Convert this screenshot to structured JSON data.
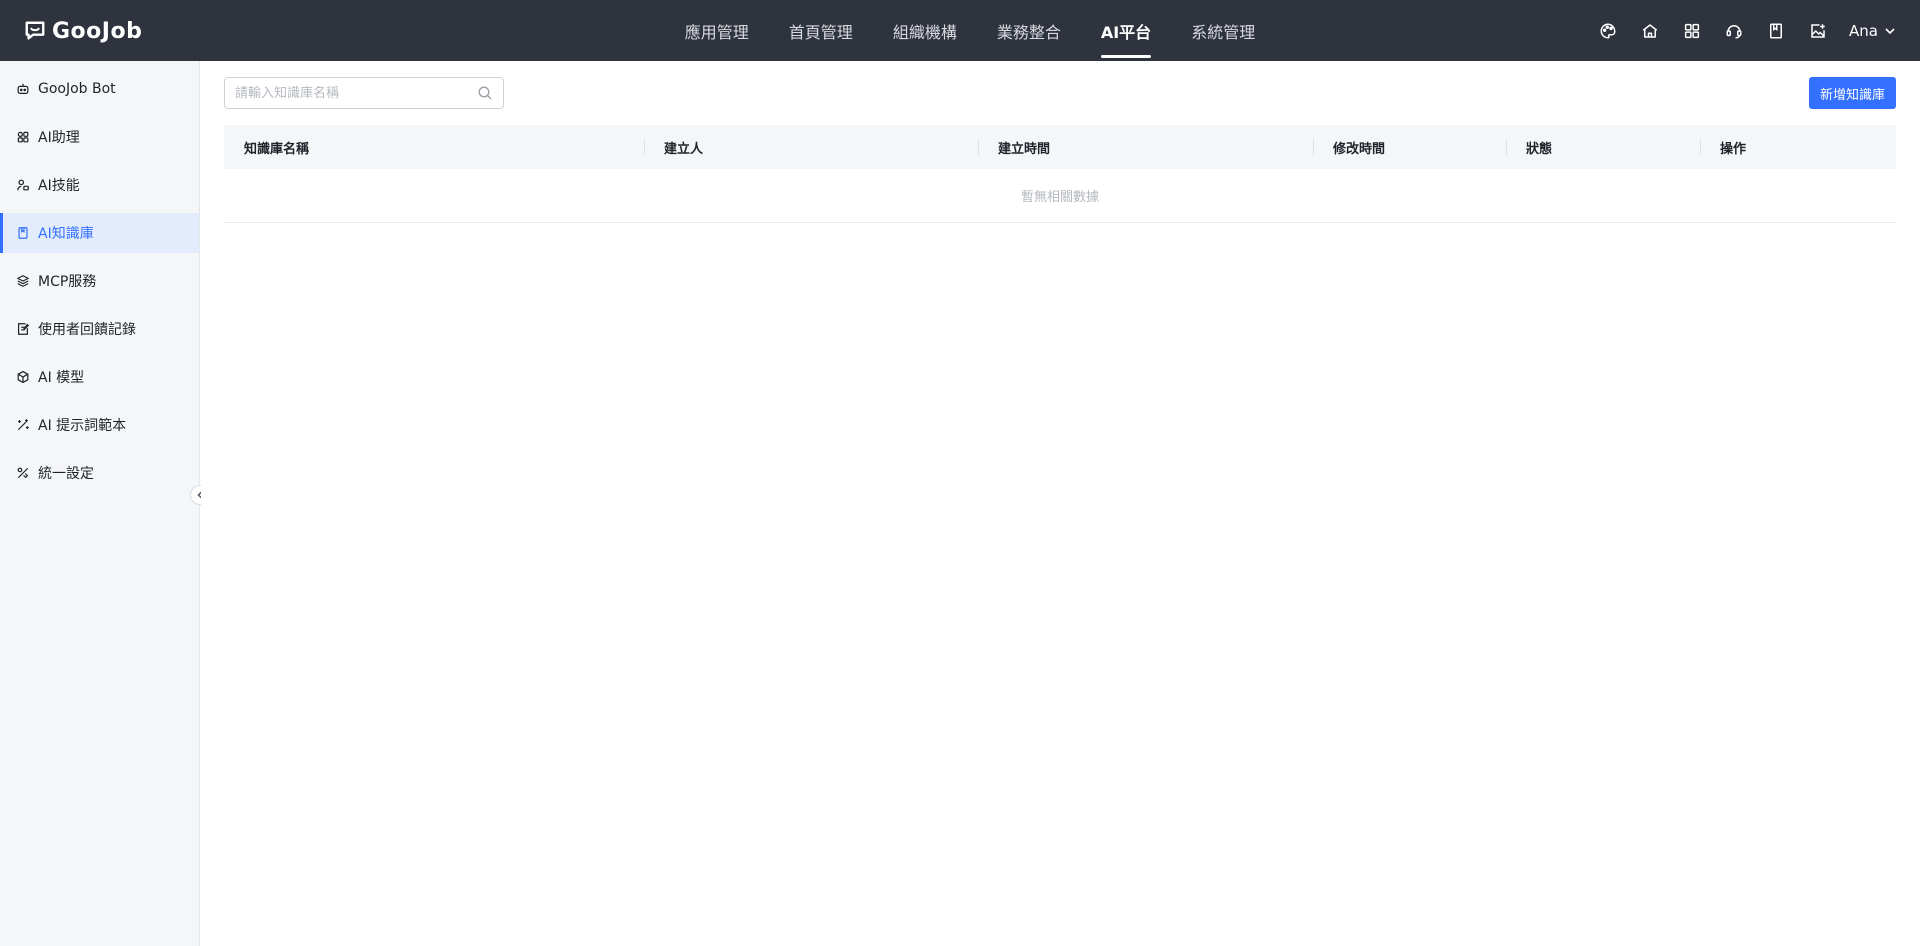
{
  "brand": {
    "name": "GooJob"
  },
  "nav": {
    "items": [
      {
        "label": "應用管理",
        "active": false
      },
      {
        "label": "首頁管理",
        "active": false
      },
      {
        "label": "組織機構",
        "active": false
      },
      {
        "label": "業務整合",
        "active": false
      },
      {
        "label": "AI平台",
        "active": true
      },
      {
        "label": "系統管理",
        "active": false
      }
    ]
  },
  "header_icons": [
    "palette-icon",
    "home-icon",
    "apps-grid-icon",
    "support-icon",
    "book-icon",
    "image-add-icon"
  ],
  "user": {
    "name": "Ana"
  },
  "sidebar": {
    "items": [
      {
        "label": "GooJob Bot",
        "icon": "bot-icon",
        "active": false
      },
      {
        "label": "AI助理",
        "icon": "grid-icon",
        "active": false
      },
      {
        "label": "AI技能",
        "icon": "skill-icon",
        "active": false
      },
      {
        "label": "AI知識庫",
        "icon": "book-icon",
        "active": true
      },
      {
        "label": "MCP服務",
        "icon": "layers-icon",
        "active": false
      },
      {
        "label": "使用者回饋記錄",
        "icon": "edit-doc-icon",
        "active": false
      },
      {
        "label": "AI 模型",
        "icon": "cube-icon",
        "active": false
      },
      {
        "label": "AI 提示詞範本",
        "icon": "magic-wand-icon",
        "active": false
      },
      {
        "label": "統一設定",
        "icon": "tools-icon",
        "active": false
      }
    ]
  },
  "search": {
    "placeholder": "請輸入知識庫名稱",
    "value": ""
  },
  "toolbar": {
    "add_label": "新增知識庫"
  },
  "table": {
    "columns": [
      "知識庫名稱",
      "建立人",
      "建立時間",
      "修改時間",
      "狀態",
      "操作"
    ],
    "rows": [],
    "empty_text": "暫無相關數據"
  },
  "colors": {
    "accent": "#3370ff",
    "topbar": "#2e333d",
    "sidebar_bg": "#f5f6f8",
    "active_bg": "#e3ecfd"
  }
}
